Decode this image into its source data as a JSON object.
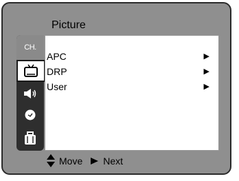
{
  "menu": {
    "title": "Picture",
    "sidebar": {
      "channel_label": "CH."
    },
    "items": [
      {
        "label": "APC"
      },
      {
        "label": "DRP"
      },
      {
        "label": "User"
      }
    ]
  },
  "footer": {
    "move_label": "Move",
    "next_label": "Next"
  },
  "colors": {
    "frame": "#8f8f8f",
    "sidebar": "#2e2e2e",
    "panel": "#ffffff",
    "selected": "#ffffff"
  }
}
